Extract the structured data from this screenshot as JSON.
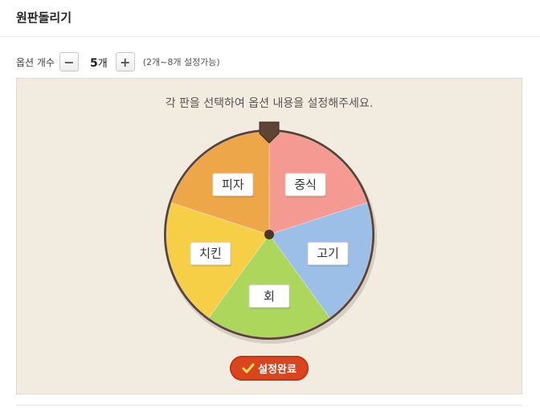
{
  "header": {
    "title": "원판돌리기"
  },
  "options": {
    "label": "옵션 개수",
    "minus_label": "−",
    "plus_label": "+",
    "count_value": "5",
    "count_unit": "개",
    "hint": "(2개~8개 설정가능)"
  },
  "board": {
    "instruction": "각 판을 선택하여 옵션 내용을 설정해주세요.",
    "done_label": "설정완료"
  },
  "wheel": {
    "segments": [
      {
        "label": "중식",
        "color": "#f49a92"
      },
      {
        "label": "고기",
        "color": "#9bbfe6"
      },
      {
        "label": "회",
        "color": "#acd65c"
      },
      {
        "label": "치킨",
        "color": "#f7cf47"
      },
      {
        "label": "피자",
        "color": "#eda648"
      }
    ],
    "rim_color": "#5a4235",
    "pointer_color": "#5e4434"
  },
  "colors": {
    "accent": "#d9451f",
    "board_bg": "#f2ebe0"
  }
}
